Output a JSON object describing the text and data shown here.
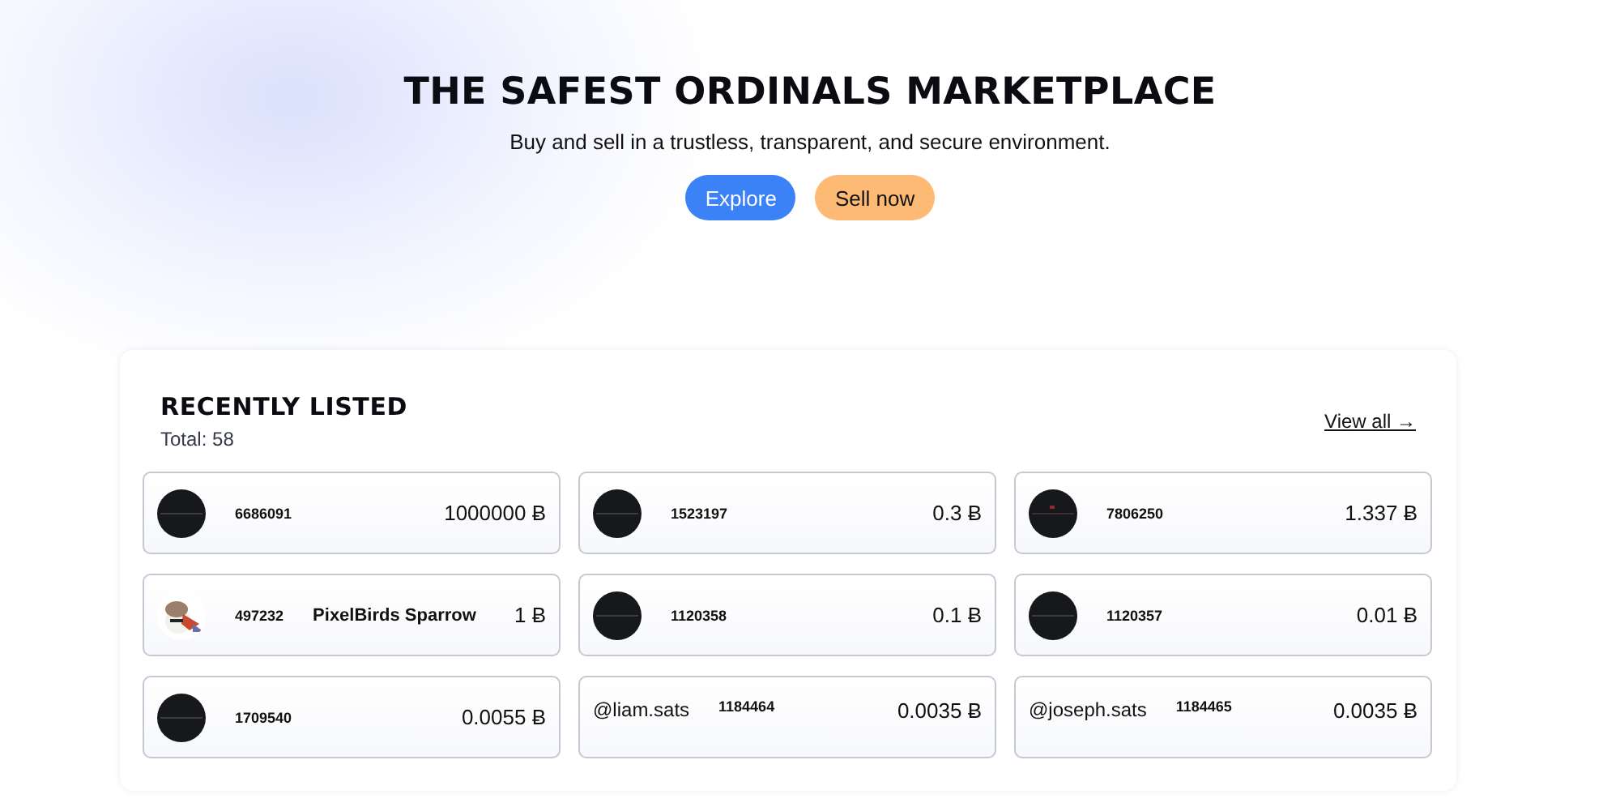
{
  "hero": {
    "title": "THE SAFEST ORDINALS MARKETPLACE",
    "subtitle": "Buy and sell in a trustless, transparent, and secure environment.",
    "buttons": [
      {
        "label": "Explore",
        "kind": "primary"
      },
      {
        "label": "Sell now",
        "kind": "secondary"
      }
    ]
  },
  "recently_listed": {
    "title": "RECENTLY LISTED",
    "total": "Total: 58",
    "view_all": "View all →",
    "listings": [
      {
        "kind": "picture",
        "number": "6686091",
        "price": "1000000 Ƀ"
      },
      {
        "kind": "picture",
        "number": "1523197",
        "price": "0.3 Ƀ"
      },
      {
        "kind": "picture",
        "number": "7806250",
        "price": "1.337 Ƀ"
      },
      {
        "kind": "picture",
        "number": "497232",
        "name": "PixelBirds Sparrow",
        "price": "1 Ƀ"
      },
      {
        "kind": "picture",
        "number": "1120358",
        "price": "0.1 Ƀ"
      },
      {
        "kind": "picture",
        "number": "1120357",
        "price": "0.01 Ƀ"
      },
      {
        "kind": "picture",
        "number": "1709540",
        "price": "0.0055 Ƀ"
      },
      {
        "kind": "handle",
        "handle": "@liam.sats",
        "number": "1184464",
        "price": "0.0035 Ƀ"
      },
      {
        "kind": "handle",
        "handle": "@joseph.sats",
        "number": "1184465",
        "price": "0.0035 Ƀ"
      }
    ]
  }
}
